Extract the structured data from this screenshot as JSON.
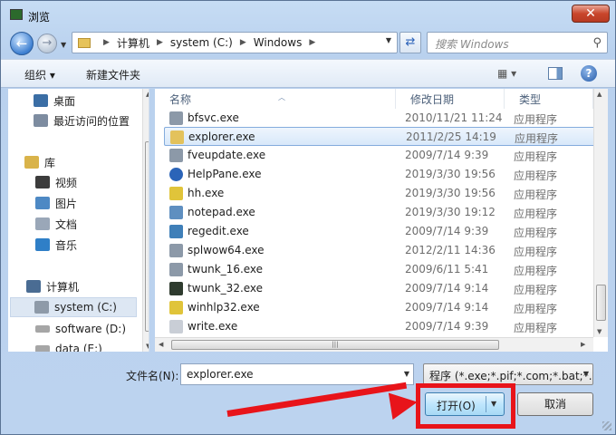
{
  "window": {
    "title": "浏览",
    "close_glyph": "✕"
  },
  "address": {
    "crumbs": [
      "计算机",
      "system (C:)",
      "Windows"
    ],
    "search_placeholder": "搜索 Windows"
  },
  "toolbar": {
    "organize": "组织 ▾",
    "new_folder": "新建文件夹",
    "help": "?"
  },
  "nav": {
    "items": [
      {
        "label": "桌面",
        "icon": "desktop-icon",
        "color": "#3b6ea5"
      },
      {
        "label": "最近访问的位置",
        "icon": "recent-places-icon",
        "color": "#7d8ca0"
      },
      {
        "label": "库",
        "icon": "library-icon",
        "color": "#d9b34a"
      },
      {
        "label": "视频",
        "icon": "video-icon",
        "color": "#3c3c3c"
      },
      {
        "label": "图片",
        "icon": "pictures-icon",
        "color": "#4e89c4"
      },
      {
        "label": "文档",
        "icon": "documents-icon",
        "color": "#9aa7b8"
      },
      {
        "label": "音乐",
        "icon": "music-icon",
        "color": "#2f7fc7"
      },
      {
        "label": "计算机",
        "icon": "computer-icon",
        "color": "#4a6c93"
      },
      {
        "label": "system (C:)",
        "icon": "drive-c-icon",
        "color": "#8e9aa8"
      },
      {
        "label": "software (D:)",
        "icon": "drive-d-icon",
        "color": "#a6a6a6"
      },
      {
        "label": "data (E:)",
        "icon": "drive-e-icon",
        "color": "#a6a6a6"
      }
    ]
  },
  "list": {
    "columns": {
      "name": "名称",
      "date": "修改日期",
      "type": "类型"
    },
    "rows": [
      {
        "name": "bfsvc.exe",
        "date": "2010/11/21 11:24",
        "type": "应用程序",
        "icon_color": "#8c99a8"
      },
      {
        "name": "explorer.exe",
        "date": "2011/2/25 14:19",
        "type": "应用程序",
        "icon_color": "#e3c25c"
      },
      {
        "name": "fveupdate.exe",
        "date": "2009/7/14 9:39",
        "type": "应用程序",
        "icon_color": "#8c99a8"
      },
      {
        "name": "HelpPane.exe",
        "date": "2019/3/30 19:56",
        "type": "应用程序",
        "icon_color": "#2b64b8"
      },
      {
        "name": "hh.exe",
        "date": "2019/3/30 19:56",
        "type": "应用程序",
        "icon_color": "#e0c43a"
      },
      {
        "name": "notepad.exe",
        "date": "2019/3/30 19:12",
        "type": "应用程序",
        "icon_color": "#5f8fc0"
      },
      {
        "name": "regedit.exe",
        "date": "2009/7/14 9:39",
        "type": "应用程序",
        "icon_color": "#3f7fb8"
      },
      {
        "name": "splwow64.exe",
        "date": "2012/2/11 14:36",
        "type": "应用程序",
        "icon_color": "#8c99a8"
      },
      {
        "name": "twunk_16.exe",
        "date": "2009/6/11 5:41",
        "type": "应用程序",
        "icon_color": "#8c99a8"
      },
      {
        "name": "twunk_32.exe",
        "date": "2009/7/14 9:14",
        "type": "应用程序",
        "icon_color": "#2e3b2e"
      },
      {
        "name": "winhlp32.exe",
        "date": "2009/7/14 9:14",
        "type": "应用程序",
        "icon_color": "#e0c43a"
      },
      {
        "name": "write.exe",
        "date": "2009/7/14 9:39",
        "type": "应用程序",
        "icon_color": "#c9ced6"
      }
    ]
  },
  "footer": {
    "filename_label": "文件名(N):",
    "filename_value": "explorer.exe",
    "filter_value": "程序 (*.exe;*.pif;*.com;*.bat;*.",
    "open_label": "打开(O)",
    "cancel_label": "取消"
  },
  "annotation": {
    "highlight_color": "#e8141a"
  }
}
